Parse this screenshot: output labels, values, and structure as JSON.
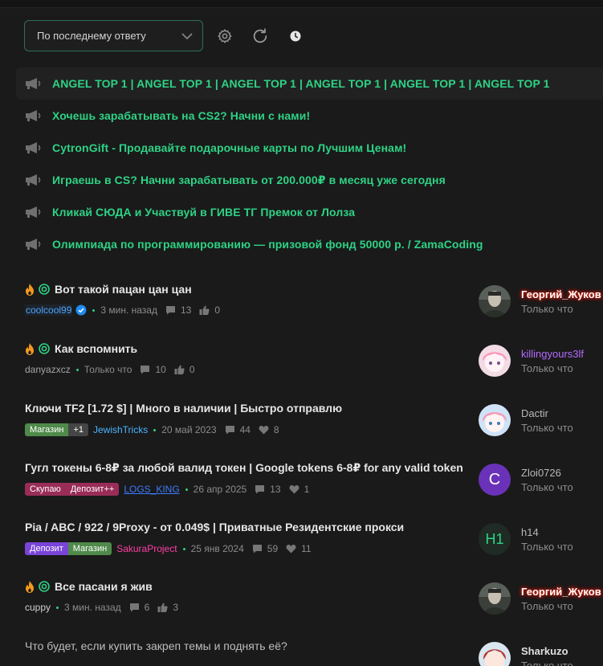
{
  "toolbar": {
    "sort_select": "По последнему ответу"
  },
  "ads": [
    {
      "text": "ANGEL TOP 1 | ANGEL TOP 1 | ANGEL TOP 1 | ANGEL TOP 1 | ANGEL TOP 1 | ANGEL TOP 1"
    },
    {
      "text": "Хочешь зарабатывать на CS2? Начни с нами!"
    },
    {
      "text": "CytronGift - Продавайте подарочные карты по Лучшим Ценам!"
    },
    {
      "text": "Играешь в CS? Начни зарабатывать от 200.000₽ в месяц уже сегодня"
    },
    {
      "text": "Кликай СЮДА и Участвуй в ГИВЕ ТГ Премок от Лолза"
    },
    {
      "text": "Олимпиада по программированию — призовой фонд 50000 р. / ZamaCoding"
    }
  ],
  "threads": [
    {
      "title": "Вот такой пацан цан цан",
      "author": "coolcool99",
      "time": "3 мин. назад",
      "replies": "13",
      "likes": "0",
      "last_user": "Георгий_Жуков",
      "last_time": "Только что"
    },
    {
      "title": "Как вспомнить",
      "author": "danyazxcz",
      "time": "Только что",
      "replies": "10",
      "likes": "0",
      "last_user": "killingyours3lf",
      "last_time": "Только что"
    },
    {
      "title": "Ключи TF2 [1.72 $] | Много в наличии | Быстро отправлю",
      "tags": [
        "Магазин",
        "+1"
      ],
      "author": "JewishTricks",
      "time": "20 май 2023",
      "replies": "44",
      "likes": "8",
      "last_user": "Dactir",
      "last_time": "Только что"
    },
    {
      "title": "Гугл токены 6-8₽ за любой валид токен | Google tokens 6-8₽ for any valid token",
      "tags": [
        "Скупаю",
        "Депозит++"
      ],
      "author": "LOGS_KING",
      "time": "26 апр 2025",
      "replies": "13",
      "likes": "1",
      "last_user": "Zloi0726",
      "last_avatar": "C",
      "last_time": "Только что"
    },
    {
      "title": "Pia / ABC / 922 / 9Proxy - от 0.049$ | Приватные Резидентские прокси",
      "tags": [
        "Депозит",
        "Магазин"
      ],
      "author": "SakuraProject",
      "time": "25 янв 2024",
      "replies": "59",
      "likes": "11",
      "last_user": "h14",
      "last_avatar": "H1",
      "last_time": "Только что"
    },
    {
      "title": "Все пасани я жив",
      "author": "cuppy",
      "time": "3 мин. назад",
      "replies": "6",
      "likes": "3",
      "last_user": "Георгий_Жуков",
      "last_time": "Только что"
    },
    {
      "title": "Что будет, если купить закреп темы и поднять её?",
      "last_user": "Sharkuzo",
      "last_time": "Только что"
    }
  ],
  "colors": {
    "accent_green": "#2ed285",
    "background": "#1a1a1a",
    "select_border": "#2f6e5a"
  }
}
